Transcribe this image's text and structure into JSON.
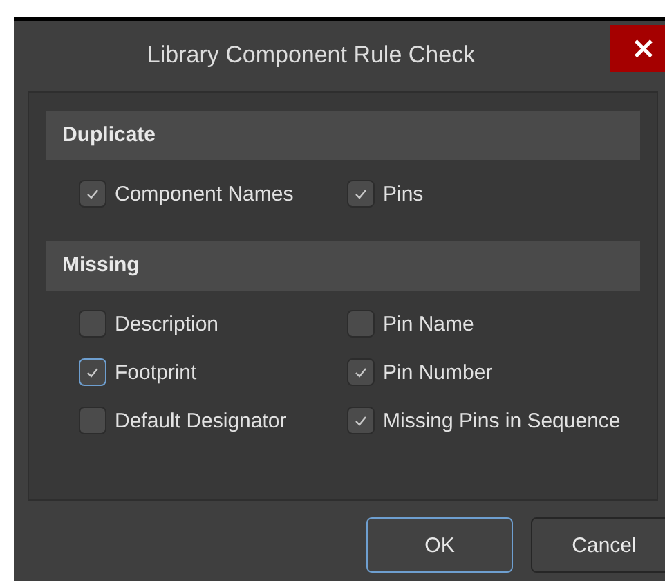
{
  "window": {
    "title": "Library Component Rule Check",
    "close": "×"
  },
  "sections": [
    {
      "title": "Duplicate",
      "items": [
        {
          "label": "Component Names",
          "checked": true,
          "focused": false
        },
        {
          "label": "Pins",
          "checked": true,
          "focused": false
        }
      ]
    },
    {
      "title": "Missing",
      "items": [
        {
          "label": "Description",
          "checked": false,
          "focused": false
        },
        {
          "label": "Pin Name",
          "checked": false,
          "focused": false
        },
        {
          "label": "Footprint",
          "checked": true,
          "focused": true
        },
        {
          "label": "Pin Number",
          "checked": true,
          "focused": false
        },
        {
          "label": "Default Designator",
          "checked": false,
          "focused": false
        },
        {
          "label": "Missing Pins in Sequence",
          "checked": true,
          "focused": false
        }
      ]
    }
  ],
  "buttons": [
    {
      "label": "OK",
      "default": true
    },
    {
      "label": "Cancel",
      "default": false
    }
  ]
}
